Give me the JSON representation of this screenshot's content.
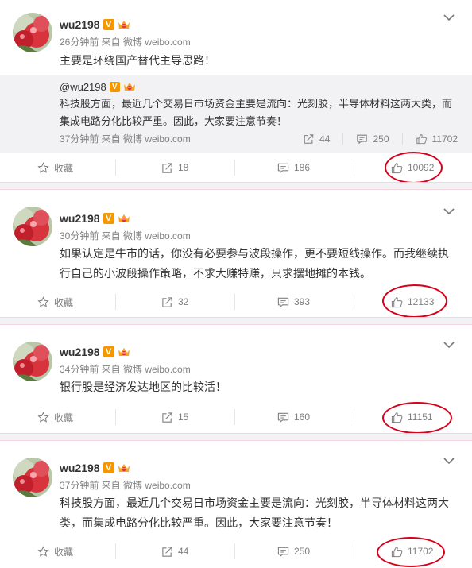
{
  "posts": [
    {
      "username": "wu2198",
      "badge": "V",
      "meta": "26分钟前 来自 微博 weibo.com",
      "text": "主要是环绕国产替代主导思路！",
      "forward": {
        "username": "@wu2198",
        "badge": "V",
        "text": "科技股方面，最近几个交易日市场资金主要是流向：光刻胶，半导体材料这两大类，而集成电路分化比较严重。因此，大家要注意节奏！",
        "meta": "37分钟前 来自 微博 weibo.com",
        "reposts": "44",
        "comments": "250",
        "likes": "11702"
      },
      "actions": {
        "favorite": "收藏",
        "reposts": "18",
        "comments": "186",
        "likes": "10092"
      }
    },
    {
      "username": "wu2198",
      "badge": "V",
      "meta": "30分钟前 来自 微博 weibo.com",
      "text": "如果认定是牛市的话，你没有必要参与波段操作，更不要短线操作。而我继续执行自己的小波段操作策略，不求大赚特赚，只求摆地摊的本钱。",
      "actions": {
        "favorite": "收藏",
        "reposts": "32",
        "comments": "393",
        "likes": "12133"
      }
    },
    {
      "username": "wu2198",
      "badge": "V",
      "meta": "34分钟前 来自 微博 weibo.com",
      "text": "银行股是经济发达地区的比较活！",
      "actions": {
        "favorite": "收藏",
        "reposts": "15",
        "comments": "160",
        "likes": "11151"
      }
    },
    {
      "username": "wu2198",
      "badge": "V",
      "meta": "37分钟前 来自 微博 weibo.com",
      "text": "科技股方面，最近几个交易日市场资金主要是流向：光刻胶，半导体材料这两大类，而集成电路分化比较严重。因此，大家要注意节奏！",
      "actions": {
        "favorite": "收藏",
        "reposts": "44",
        "comments": "250",
        "likes": "11702"
      }
    }
  ],
  "colors": {
    "highlight_circle": "#d9001b",
    "badge": "#f39800",
    "separator": "#f6d6de"
  },
  "icons": [
    "avatar-photo",
    "v-badge",
    "crown-icon",
    "chevron-down-icon",
    "star-icon",
    "repost-icon",
    "comment-icon",
    "thumbs-up-icon"
  ]
}
